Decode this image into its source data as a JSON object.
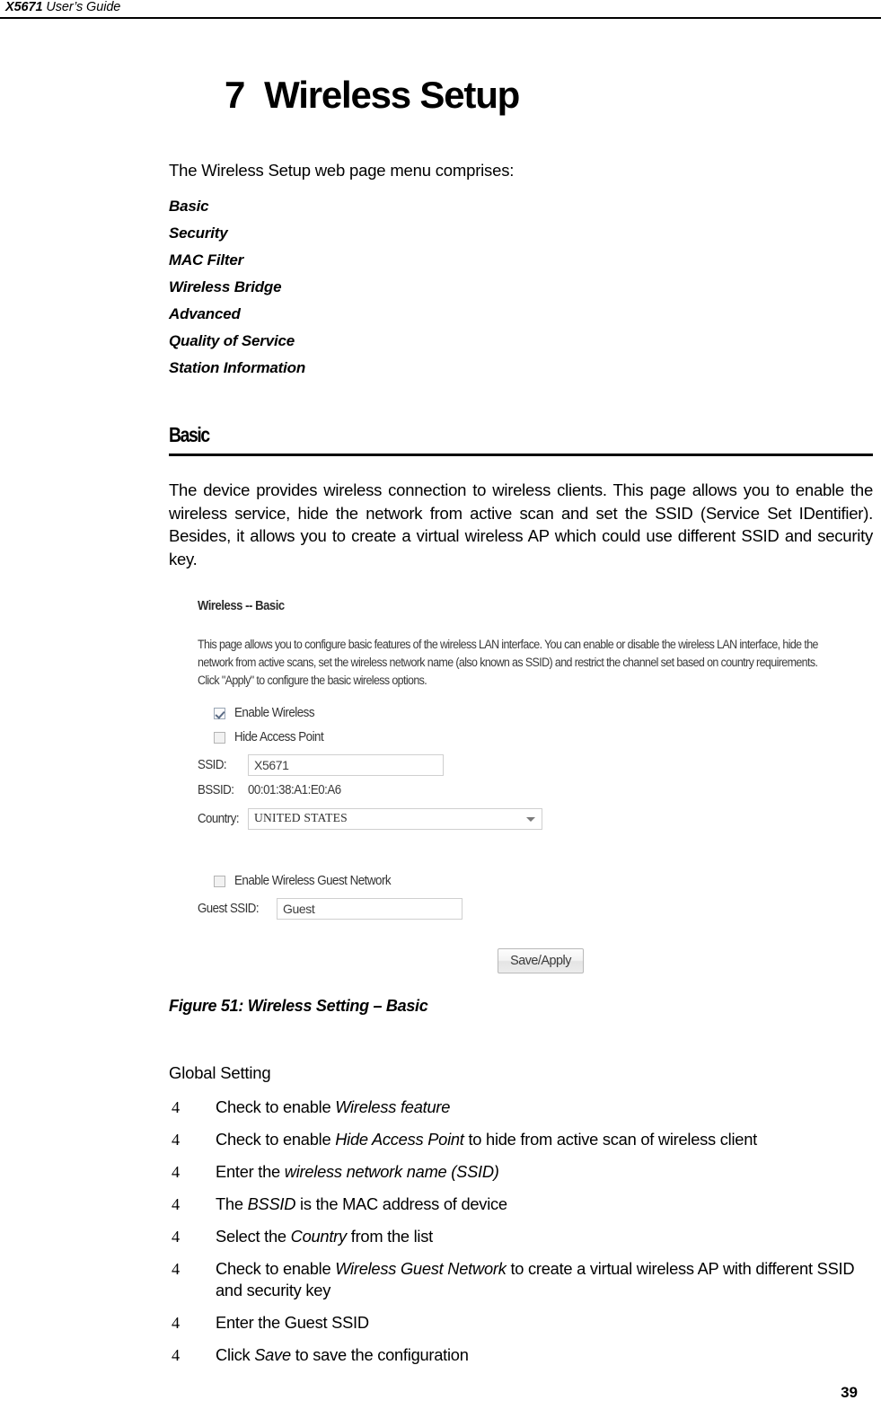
{
  "header": {
    "model": "X5671",
    "doc_title": " User’s Guide"
  },
  "chapter": {
    "number": "7",
    "title": "Wireless Setup"
  },
  "intro": {
    "line": "The Wireless Setup web page menu comprises:"
  },
  "menu": {
    "items": [
      {
        "label": "Basic"
      },
      {
        "label": "Security"
      },
      {
        "label": "MAC Filter"
      },
      {
        "label": "Wireless Bridge"
      },
      {
        "label": "Advanced"
      },
      {
        "label": "Quality of Service"
      },
      {
        "label": "Station Information"
      }
    ]
  },
  "section": {
    "heading": "Basic",
    "paragraph": "The device provides wireless connection to wireless clients. This page allows you to enable the wireless service, hide the network from active scan and set the SSID (Service Set IDentifier). Besides, it allows you to create a virtual wireless AP which could use different SSID and security key."
  },
  "figure": {
    "ui": {
      "title": "Wireless -- Basic",
      "description": "This page allows you to configure basic features of the wireless LAN interface. You can enable or disable the wireless LAN interface, hide the network from active scans, set the wireless network name (also known as SSID) and restrict the channel set based on country requirements. Click \"Apply\" to configure the basic wireless options.",
      "enable_wireless_label": "Enable Wireless",
      "enable_wireless_checked": true,
      "hide_ap_label": "Hide Access Point",
      "hide_ap_checked": false,
      "ssid_label": "SSID:",
      "ssid_value": "X5671",
      "bssid_label": "BSSID:",
      "bssid_value": "00:01:38:A1:E0:A6",
      "country_label": "Country:",
      "country_value": "UNITED STATES",
      "guest_enable_label": "Enable Wireless Guest Network",
      "guest_enable_checked": false,
      "guest_ssid_label": "Guest SSID:",
      "guest_ssid_value": "Guest",
      "save_button_label": "Save/Apply"
    },
    "caption": "Figure 51: Wireless Setting – Basic"
  },
  "global_setting": {
    "label": "Global Setting",
    "bullet_mark": "4",
    "bullets": [
      {
        "pre": "Check to enable ",
        "em": "Wireless feature",
        "post": ""
      },
      {
        "pre": "Check to enable ",
        "em": "Hide Access Point",
        "post": " to hide from active scan of wireless client"
      },
      {
        "pre": "Enter the ",
        "em": "wireless network name (SSID)",
        "post": ""
      },
      {
        "pre": "The ",
        "em": "BSSID",
        "post": " is the MAC address of device"
      },
      {
        "pre": "Select the ",
        "em": "Country",
        "post": " from the list"
      },
      {
        "pre": "Check to enable ",
        "em": "Wireless Guest Network",
        "post": " to create a virtual wireless AP with different SSID and security key"
      },
      {
        "pre": "Enter the Guest SSID",
        "em": "",
        "post": ""
      },
      {
        "pre": "Click ",
        "em": "Save",
        "post": " to save the configuration"
      }
    ]
  },
  "footer": {
    "page_number": "39"
  }
}
